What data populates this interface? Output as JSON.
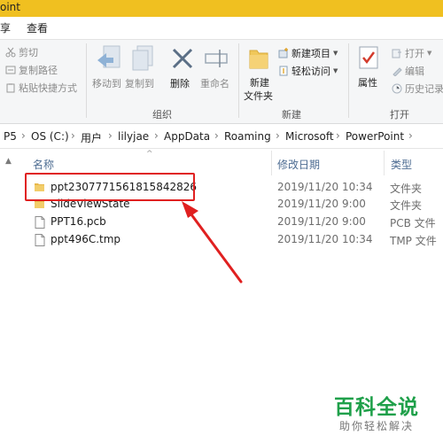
{
  "window": {
    "title": "oint"
  },
  "menu": {
    "item_left": "享",
    "item_view": "查看"
  },
  "ribbon": {
    "clipboard": {
      "cut": "剪切",
      "copy_path": "复制路径",
      "paste_shortcut": "粘贴快捷方式"
    },
    "organize": {
      "move_to": "移动到",
      "copy_to": "复制到",
      "delete": "删除",
      "rename": "重命名",
      "group_label": "组织"
    },
    "new": {
      "new_folder_line1": "新建",
      "new_folder_line2": "文件夹",
      "new_item": "新建项目",
      "easy_access": "轻松访问",
      "group_label": "新建"
    },
    "open": {
      "properties": "属性",
      "open": "打开",
      "edit": "编辑",
      "history": "历史记录",
      "group_label": "打开"
    }
  },
  "address": {
    "crumbs": [
      "P5",
      "OS (C:)",
      "用户",
      "lilyjae",
      "AppData",
      "Roaming",
      "Microsoft",
      "PowerPoint"
    ]
  },
  "columns": {
    "name": "名称",
    "date": "修改日期",
    "type": "类型"
  },
  "files": [
    {
      "name": "ppt2307771561815842826",
      "date": "2019/11/20 10:34",
      "type": "文件夹",
      "icon": "folder-icon"
    },
    {
      "name": "SlideViewState",
      "date": "2019/11/20 9:00",
      "type": "文件夹",
      "icon": "folder-icon"
    },
    {
      "name": "PPT16.pcb",
      "date": "2019/11/20 9:00",
      "type": "PCB 文件",
      "icon": "file-icon"
    },
    {
      "name": "ppt496C.tmp",
      "date": "2019/11/20 10:34",
      "type": "TMP 文件",
      "icon": "file-icon"
    }
  ],
  "watermark": {
    "brand": "百科全说",
    "slogan": "助你轻松解决"
  },
  "colors": {
    "titlebar": "#f0c020",
    "annotation": "#e02020",
    "watermark": "#1fa04a",
    "folder": "#e8b84a"
  }
}
